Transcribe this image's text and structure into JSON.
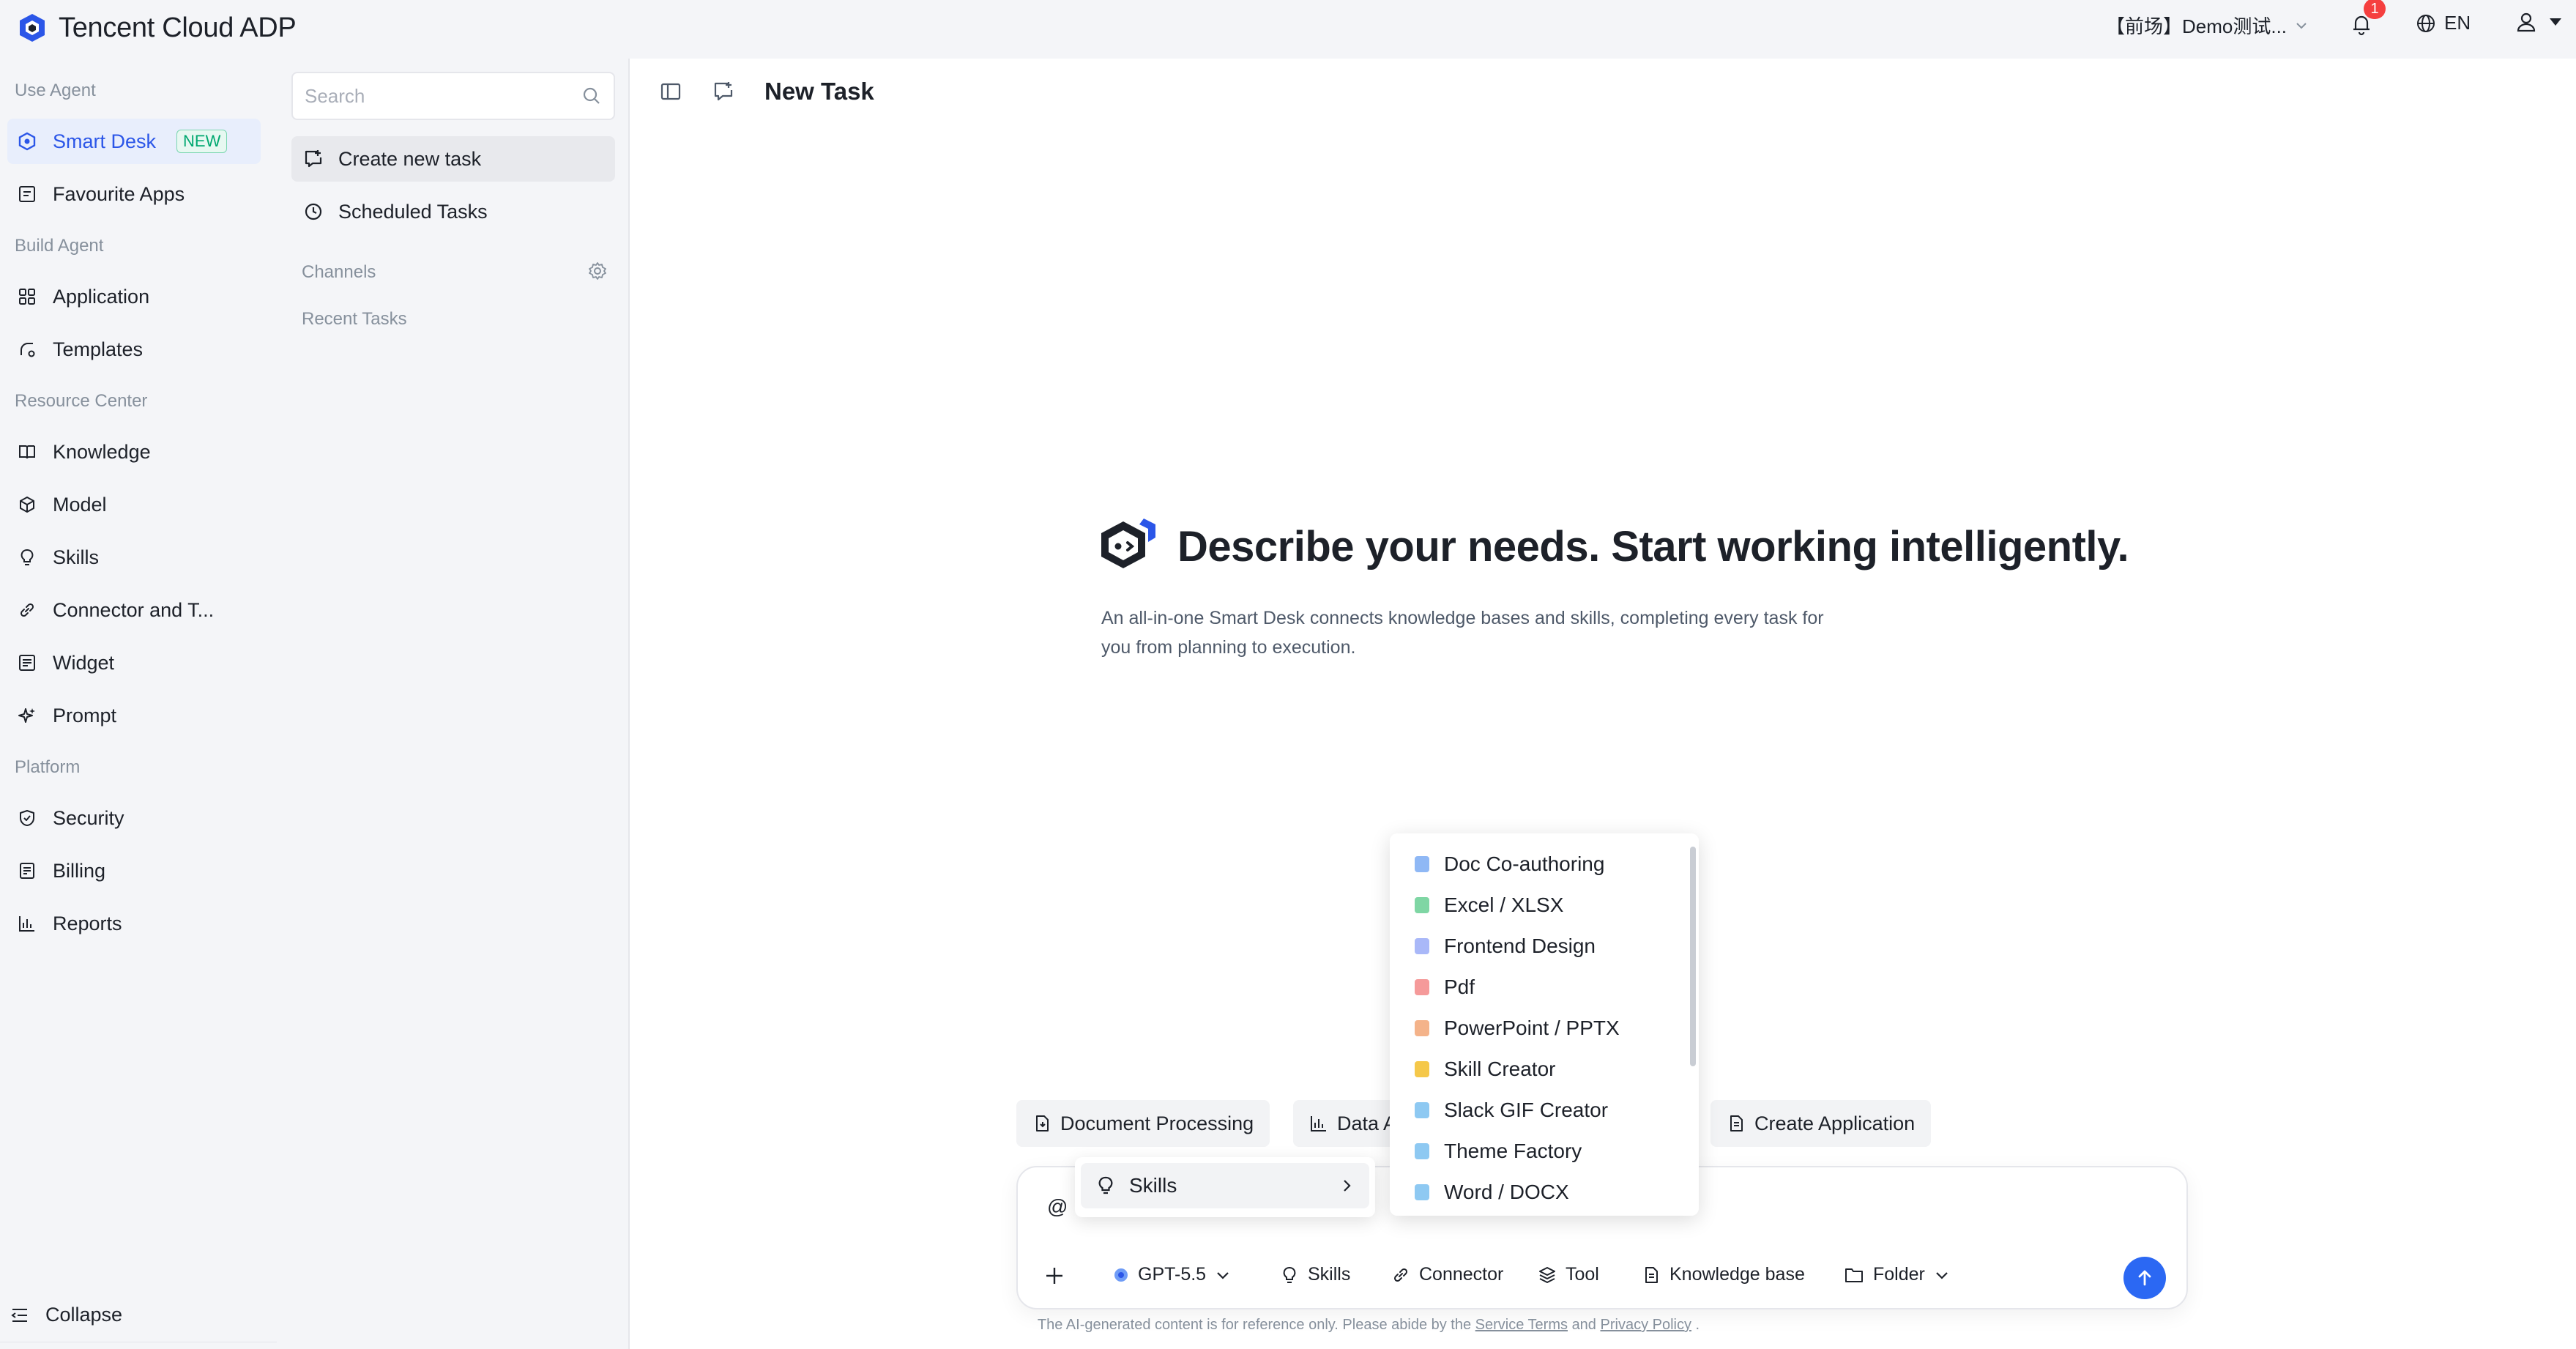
{
  "topbar": {
    "brand": "Tencent Cloud ADP",
    "workspace": "【前场】Demo测试...",
    "notifications_count": "1",
    "language": "EN"
  },
  "sidebar": {
    "sections": {
      "use_agent": "Use Agent",
      "build_agent": "Build Agent",
      "resource_center": "Resource Center",
      "platform": "Platform"
    },
    "items": {
      "smart_desk": "Smart Desk",
      "smart_desk_tag": "NEW",
      "favourite_apps": "Favourite Apps",
      "application": "Application",
      "templates": "Templates",
      "knowledge": "Knowledge",
      "model": "Model",
      "skills": "Skills",
      "connector": "Connector and T...",
      "widget": "Widget",
      "prompt": "Prompt",
      "security": "Security",
      "billing": "Billing",
      "reports": "Reports"
    },
    "collapse": "Collapse"
  },
  "taskpanel": {
    "search_placeholder": "Search",
    "create_new_task": "Create new task",
    "scheduled_tasks": "Scheduled Tasks",
    "channels": "Channels",
    "recent_tasks": "Recent Tasks"
  },
  "main": {
    "title": "New Task",
    "hero_title": "Describe your needs. Start working intelligently.",
    "hero_sub": "An all-in-one Smart Desk connects knowledge bases and skills, completing every task for you from planning to execution.",
    "chips": {
      "document_processing": "Document Processing",
      "data": "Data A",
      "create_application": "Create Application"
    },
    "input_text": "@",
    "toolbar": {
      "model": "GPT-5.5",
      "skills": "Skills",
      "connector": "Connector",
      "tool": "Tool",
      "knowledge_base": "Knowledge base",
      "folder": "Folder"
    },
    "footer": {
      "prefix": "The AI-generated content is for reference only. Please abide by the",
      "service_terms": "Service Terms",
      "and": "and",
      "privacy_policy": "Privacy Policy",
      "suffix": "."
    }
  },
  "skills_popover": {
    "label": "Skills"
  },
  "skill_menu": {
    "items": [
      {
        "label": "Doc Co-authoring",
        "color": "#8fb8f5"
      },
      {
        "label": "Excel / XLSX",
        "color": "#7fd6a4"
      },
      {
        "label": "Frontend Design",
        "color": "#a9b8f8"
      },
      {
        "label": "Pdf",
        "color": "#f59a9a"
      },
      {
        "label": "PowerPoint / PPTX",
        "color": "#f4b38a"
      },
      {
        "label": "Skill Creator",
        "color": "#f5c84a"
      },
      {
        "label": "Slack GIF Creator",
        "color": "#8ec9f2"
      },
      {
        "label": "Theme Factory",
        "color": "#8ec9f2"
      },
      {
        "label": "Word / DOCX",
        "color": "#8ec9f2"
      }
    ]
  }
}
